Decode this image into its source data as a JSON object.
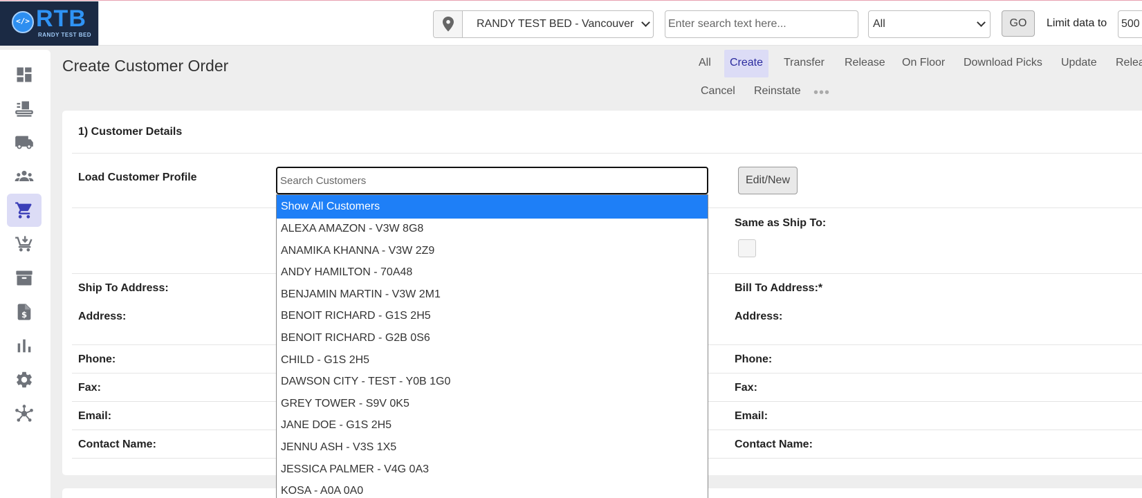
{
  "topbar": {
    "logo_text": "RTB",
    "logo_sub": "RANDY TEST BED",
    "location": "RANDY TEST BED - Vancouver",
    "search_placeholder": "Enter search text here...",
    "filter_value": "All",
    "go_label": "GO",
    "limit_label": "Limit data to",
    "limit_value": "500"
  },
  "sidebar": {
    "items": [
      {
        "icon": "dashboard-icon",
        "active": false
      },
      {
        "icon": "receiving-icon",
        "active": false
      },
      {
        "icon": "truck-icon",
        "active": false
      },
      {
        "icon": "users-icon",
        "active": false
      },
      {
        "icon": "cart-icon",
        "active": true
      },
      {
        "icon": "cart-return-icon",
        "active": false
      },
      {
        "icon": "archive-icon",
        "active": false
      },
      {
        "icon": "invoice-icon",
        "active": false
      },
      {
        "icon": "bar-chart-icon",
        "active": false
      },
      {
        "icon": "gear-icon",
        "active": false
      },
      {
        "icon": "network-icon",
        "active": false
      }
    ]
  },
  "header": {
    "title": "Create Customer Order",
    "tabs": [
      "All",
      "Create",
      "Transfer",
      "Release",
      "On Floor",
      "Download Picks",
      "Update",
      "Relea",
      "Cancel",
      "Reinstate"
    ],
    "active_tab": "Create"
  },
  "customer_details": {
    "section_title": "1) Customer Details",
    "load_profile_label": "Load Customer Profile",
    "search_placeholder": "Search Customers",
    "edit_button": "Edit/New",
    "same_as_ship_label": "Same as Ship To:",
    "ship_to_label": "Ship To Address:",
    "bill_to_label": "Bill To Address:*",
    "address_label": "Address:",
    "phone_label": "Phone:",
    "fax_label": "Fax:",
    "email_label": "Email:",
    "contact_label": "Contact Name:"
  },
  "dropdown": {
    "items": [
      "Show All Customers",
      "ALEXA AMAZON - V3W 8G8",
      "ANAMIKA KHANNA - V3W 2Z9",
      "ANDY HAMILTON - 70A48",
      "BENJAMIN MARTIN - V3W 2M1",
      "BENOIT RICHARD - G1S 2H5",
      "BENOIT RICHARD - G2B 0S6",
      "CHILD - G1S 2H5",
      "DAWSON CITY - TEST - Y0B 1G0",
      "GREY TOWER - S9V 0K5",
      "JANE DOE - G1S 2H5",
      "JENNU ASH - V3S 1X5",
      "JESSICA PALMER - V4G 0A3",
      "KOSA - A0A 0A0"
    ],
    "highlight_color": "#1e7ff7"
  },
  "colors": {
    "accent": "#2b2b9f",
    "active_bg": "#dcdcf6",
    "icon_gray": "#6f737a"
  }
}
